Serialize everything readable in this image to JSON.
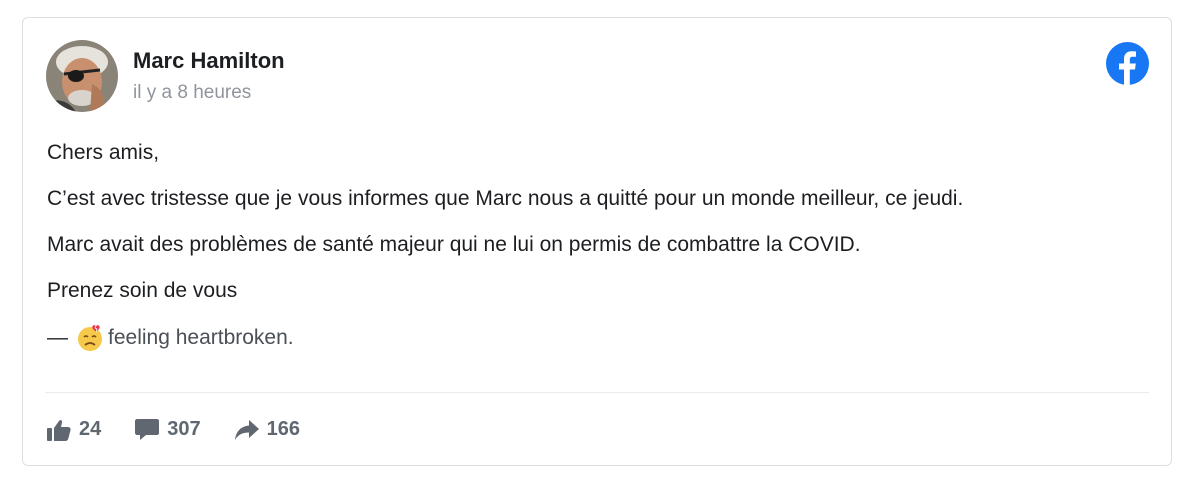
{
  "post": {
    "author": "Marc Hamilton",
    "time": "il y a 8 heures",
    "paragraphs": [
      "Chers amis,",
      "C’est avec tristesse que je vous informes que Marc nous a quitté pour un monde meilleur, ce jeudi.",
      "Marc avait des problèmes de santé majeur qui ne lui on permis de combattre la COVID.",
      "Prenez soin de vous"
    ],
    "feeling": {
      "dash": "—",
      "text": "feeling heartbroken.",
      "emoji_icon": "heartbroken-emoji-icon"
    }
  },
  "actions": {
    "likes": "24",
    "comments": "307",
    "shares": "166"
  },
  "colors": {
    "facebook_blue": "#1877f2",
    "action_gray": "#606770"
  }
}
